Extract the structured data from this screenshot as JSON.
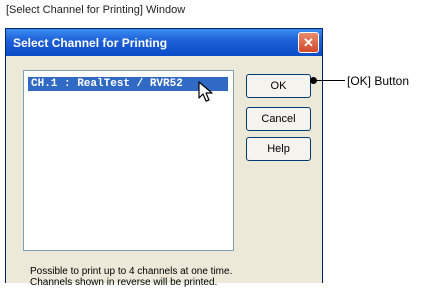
{
  "caption": "[Select Channel for Printing] Window",
  "window": {
    "title": "Select Channel for Printing",
    "close_symbol": "✕"
  },
  "channel_list": {
    "items": [
      "CH.1 : RealTest / RVR52"
    ],
    "selected_index": 0
  },
  "buttons": {
    "ok_label": "OK",
    "cancel_label": "Cancel",
    "help_label": "Help"
  },
  "notes": {
    "line1": "Possible to print up to 4 channels at one time.",
    "line2": "Channels shown in reverse will be printed."
  },
  "callout": {
    "label": "[OK] Button"
  },
  "colors": {
    "titlebar": "#0a4bc8",
    "selection": "#316ac5",
    "close_button": "#d3472c"
  },
  "icons": {
    "cursor": "arrow-pointer-icon",
    "close": "close-icon"
  }
}
